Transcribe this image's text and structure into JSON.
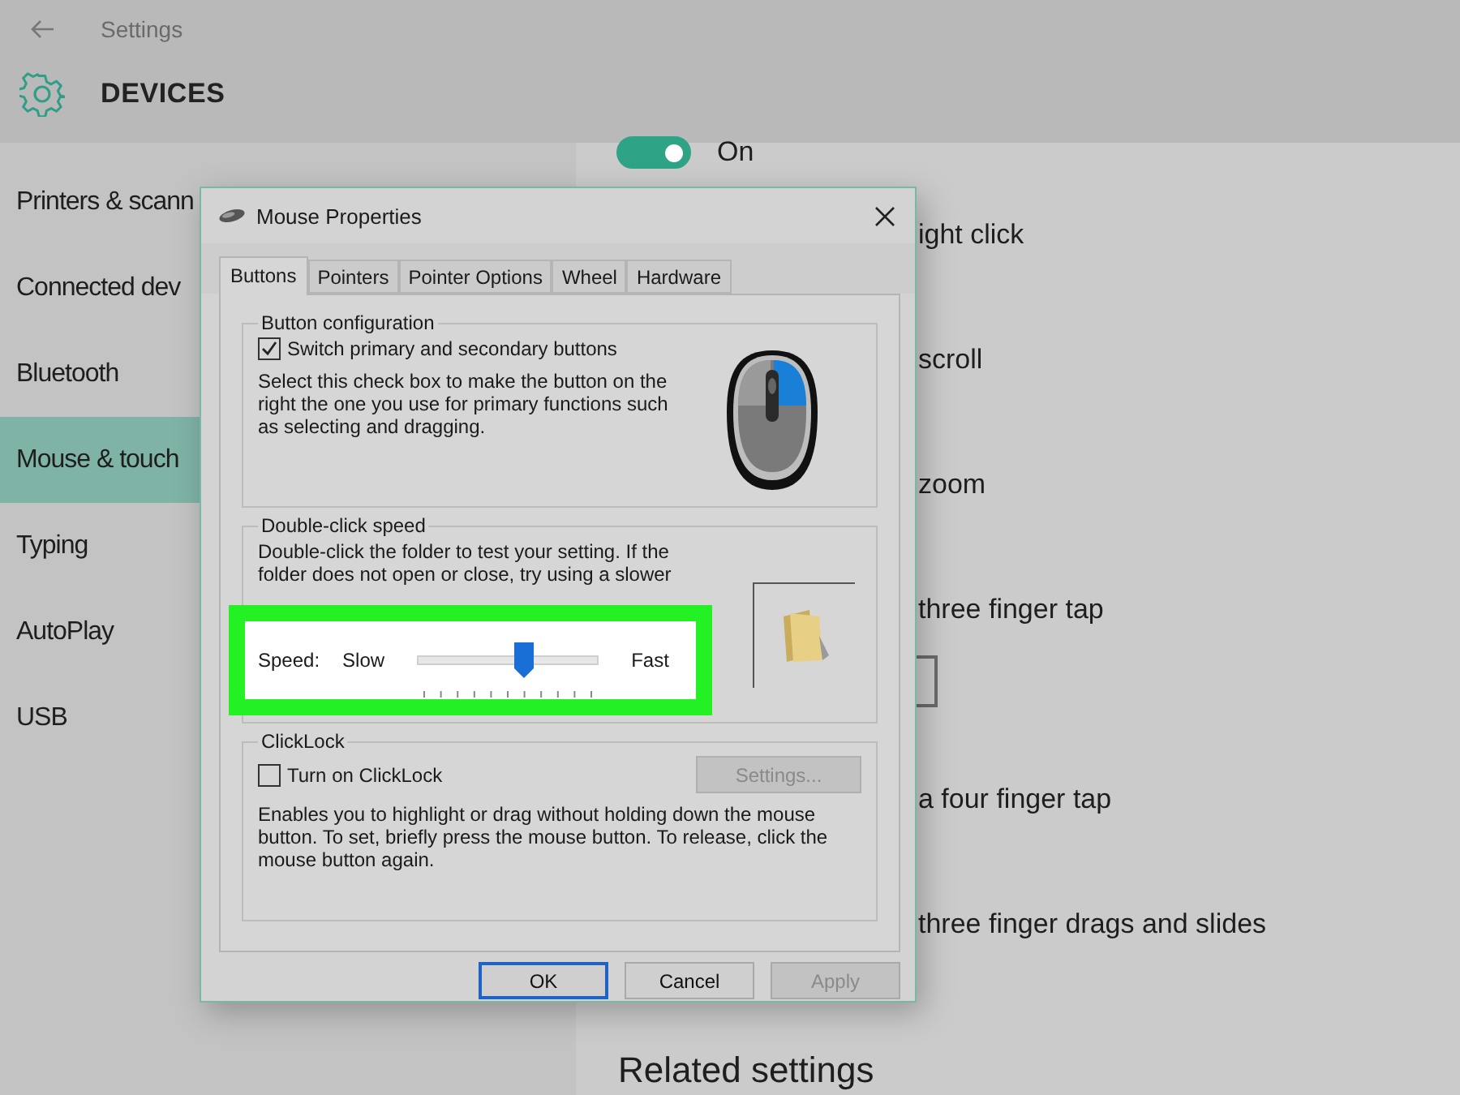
{
  "header": {
    "title": "Settings",
    "section": "DEVICES"
  },
  "sidebar": {
    "items": [
      {
        "label": "Printers & scann",
        "selected": false
      },
      {
        "label": "Connected dev",
        "selected": false
      },
      {
        "label": "Bluetooth",
        "selected": false
      },
      {
        "label": "Mouse & touch",
        "selected": true
      },
      {
        "label": "Typing",
        "selected": false
      },
      {
        "label": "AutoPlay",
        "selected": false
      },
      {
        "label": "USB",
        "selected": false
      }
    ]
  },
  "content": {
    "toggle": {
      "on": true,
      "label": "On"
    },
    "items": [
      {
        "kind": "text",
        "label": "ight click"
      },
      {
        "kind": "text",
        "label": "scroll"
      },
      {
        "kind": "text",
        "label": "zoom"
      },
      {
        "kind": "text",
        "label": "three finger tap"
      },
      {
        "kind": "dropdown"
      },
      {
        "kind": "text",
        "label": "a four finger tap"
      },
      {
        "kind": "text",
        "label": "three finger drags and slides"
      }
    ],
    "related_heading": "Related settings"
  },
  "dialog": {
    "title": "Mouse Properties",
    "tabs": [
      {
        "label": "Buttons",
        "selected": true
      },
      {
        "label": "Pointers",
        "selected": false
      },
      {
        "label": "Pointer Options",
        "selected": false
      },
      {
        "label": "Wheel",
        "selected": false
      },
      {
        "label": "Hardware",
        "selected": false
      }
    ],
    "button_configuration": {
      "legend": "Button configuration",
      "checkbox": {
        "label": "Switch primary and secondary buttons",
        "checked": true
      },
      "description": "Select this check box to make the button on the right the one you use for primary functions such as selecting and dragging."
    },
    "double_click_speed": {
      "legend": "Double-click speed",
      "description": "Double-click the folder to test your setting. If the folder does not open or close, try using a slower",
      "speed_label": "Speed:",
      "slow_label": "Slow",
      "fast_label": "Fast",
      "level": 0.59,
      "highlighted": true
    },
    "clicklock": {
      "legend": "ClickLock",
      "checkbox": {
        "label": "Turn on ClickLock",
        "checked": false
      },
      "settings_button": {
        "label": "Settings...",
        "disabled": true
      },
      "description": "Enables you to highlight or drag without holding down the mouse button. To set, briefly press the mouse button. To release, click the mouse button again."
    },
    "buttons": [
      {
        "label": "OK",
        "default": true,
        "disabled": false
      },
      {
        "label": "Cancel",
        "default": false,
        "disabled": false
      },
      {
        "label": "Apply",
        "default": false,
        "disabled": true
      }
    ]
  }
}
